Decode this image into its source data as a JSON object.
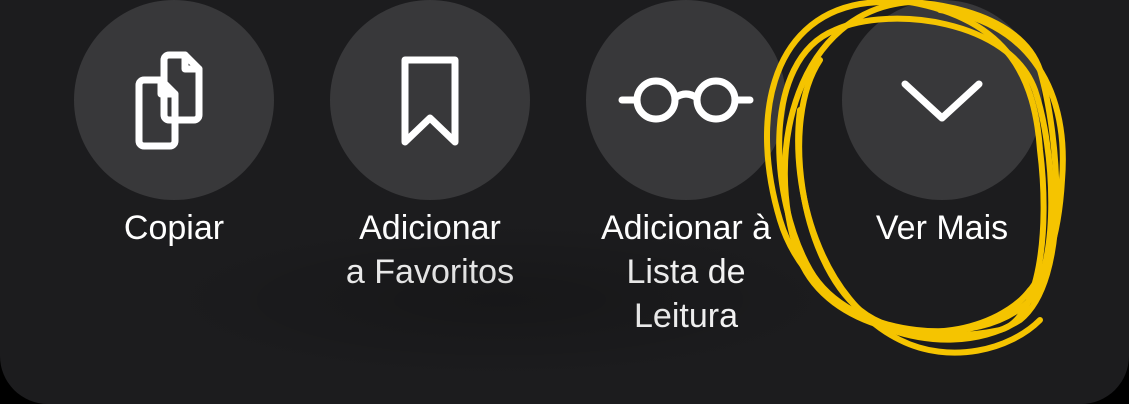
{
  "actions": [
    {
      "id": "copy",
      "label": "Copiar",
      "icon": "copy-icon"
    },
    {
      "id": "bookmark",
      "label": "Adicionar\na Favoritos",
      "icon": "bookmark-icon"
    },
    {
      "id": "reading-list",
      "label": "Adicionar à\nLista de\nLeitura",
      "icon": "glasses-icon"
    },
    {
      "id": "more",
      "label": "Ver Mais",
      "icon": "chevron-down-icon"
    }
  ],
  "colors": {
    "sheet": "#1c1c1e",
    "button": "#38383a",
    "text": "#ffffff",
    "annotation": "#f5c400"
  }
}
